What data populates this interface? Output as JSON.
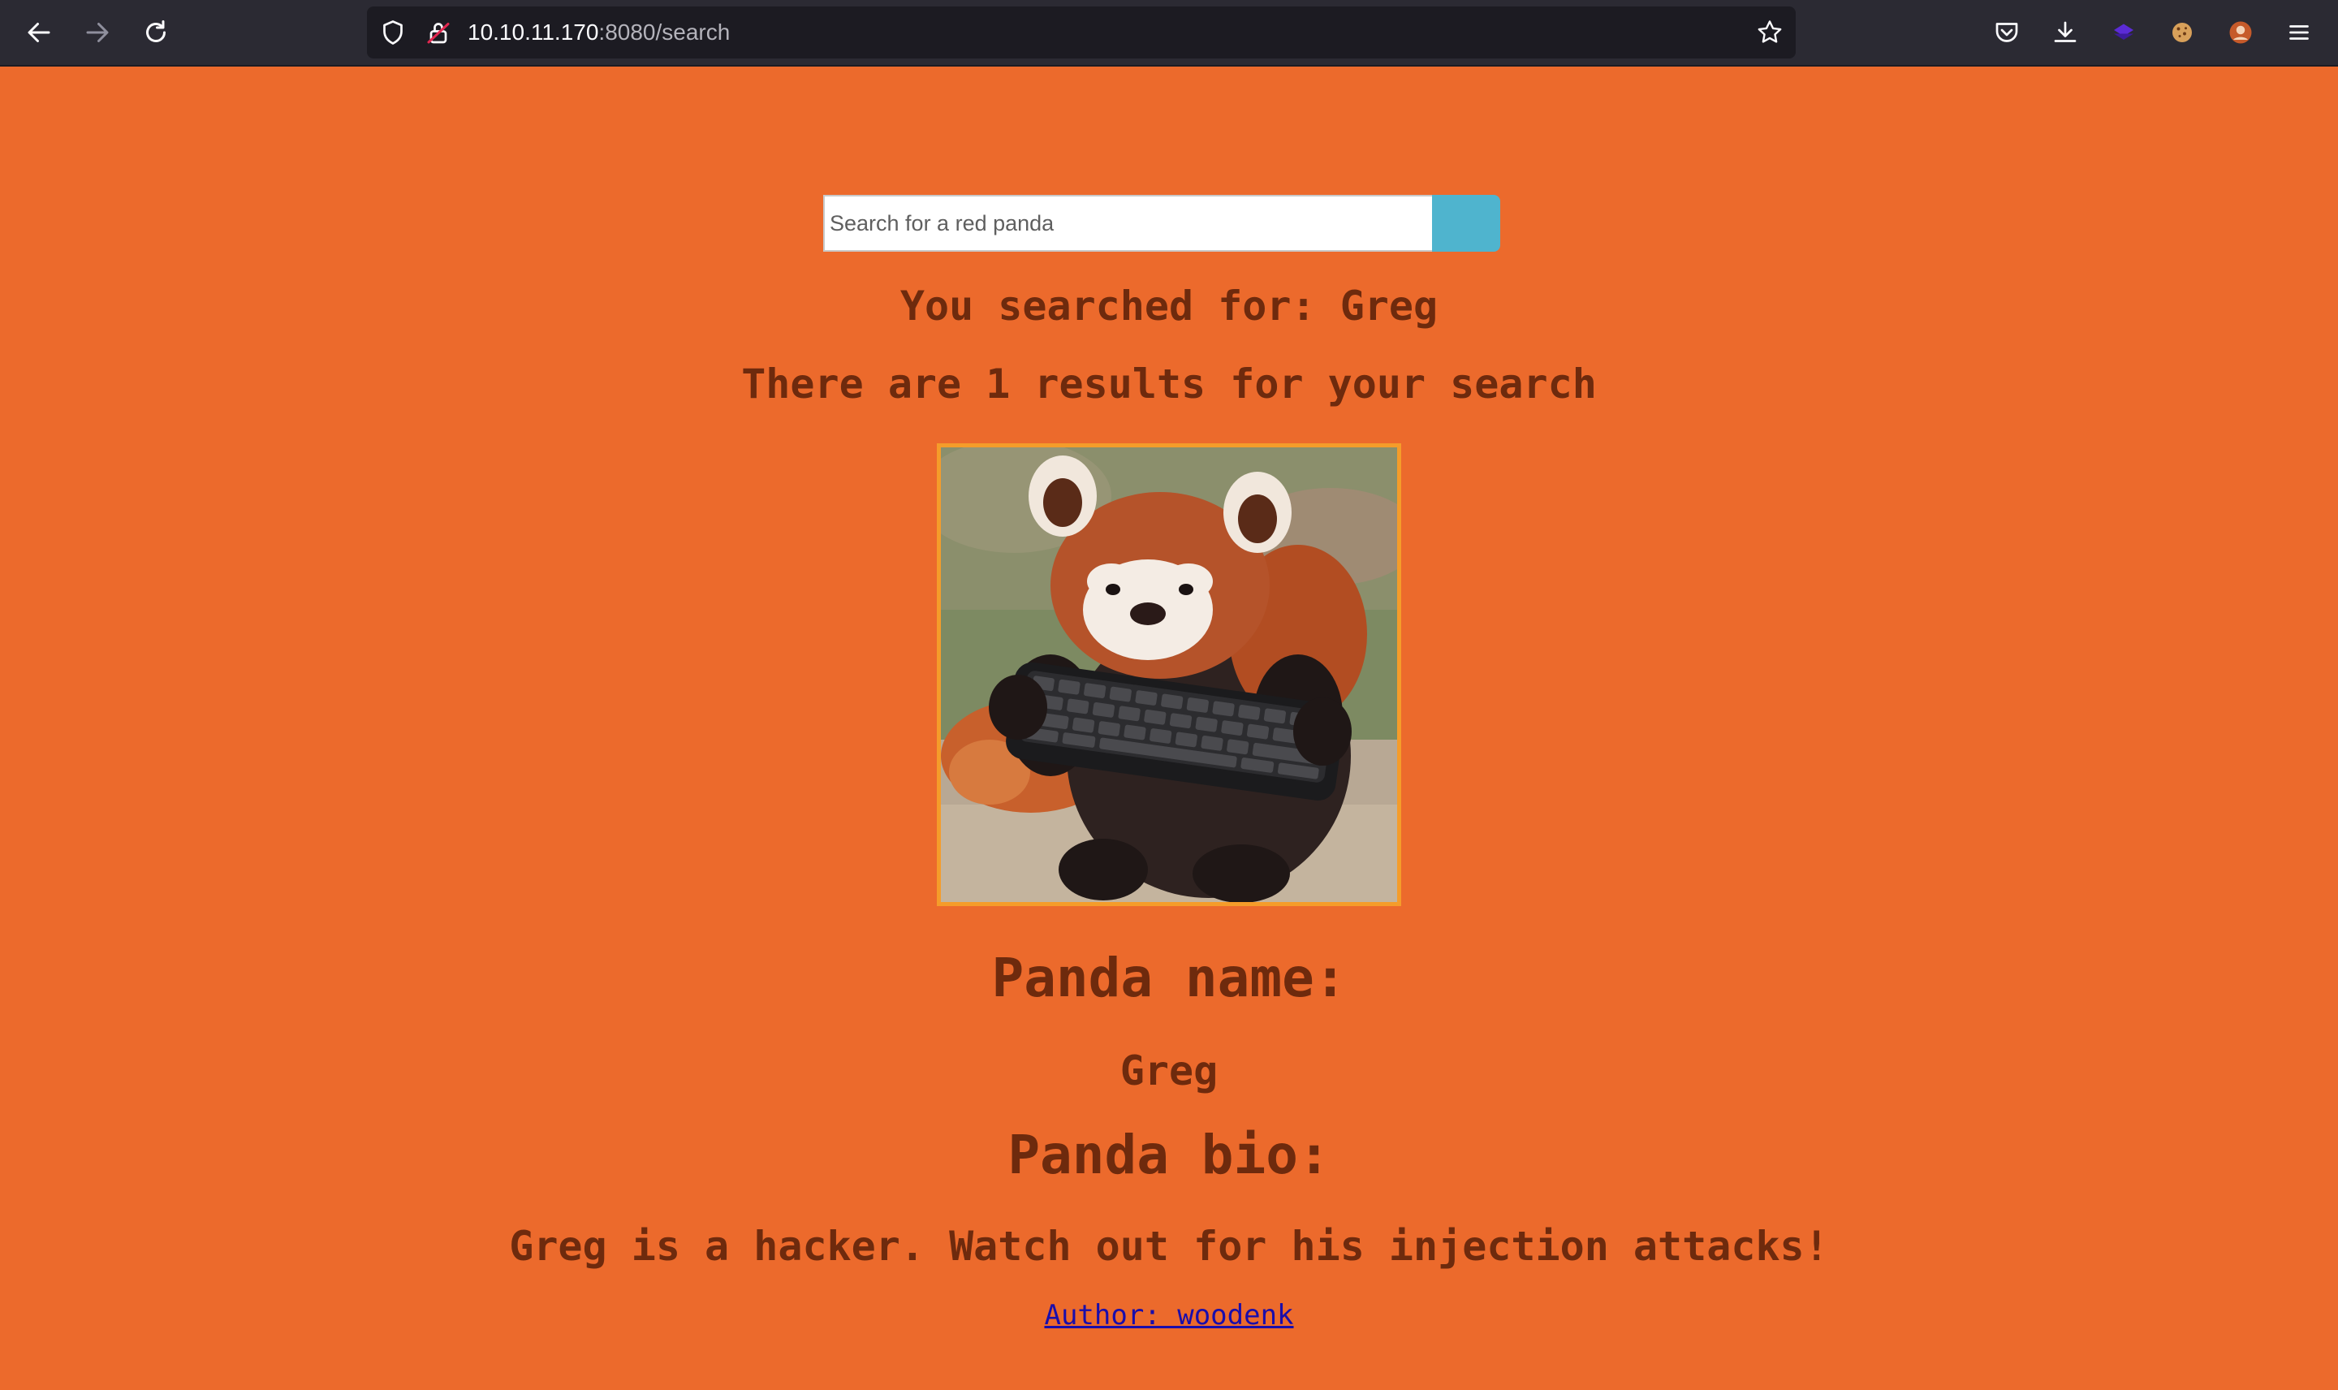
{
  "browser": {
    "url_host": "10.10.11.170",
    "url_rest": ":8080/search",
    "icons": [
      "back-arrow-icon",
      "forward-arrow-icon",
      "reload-icon",
      "shield-icon",
      "insecure-lock-icon",
      "bookmark-star-icon",
      "pocket-icon",
      "download-icon",
      "extension-icon",
      "cookie-icon",
      "profile-icon",
      "menu-icon"
    ]
  },
  "search": {
    "placeholder": "Search for a red panda",
    "value": ""
  },
  "results": {
    "searched_for": "You searched for: Greg",
    "count_text": "There are 1 results for your search",
    "image_alt": "red panda holding a keyboard",
    "name_heading": "Panda name:",
    "name": "Greg",
    "bio_heading": "Panda bio:",
    "bio": "Greg is a hacker. Watch out for his injection attacks!",
    "author_link": "Author: woodenk"
  },
  "colors": {
    "page_background": "#ec6a2c",
    "text": "#6e2a0d",
    "search_button": "#4fb4ce",
    "image_border": "#f59c2a",
    "link": "#1a0dab"
  }
}
